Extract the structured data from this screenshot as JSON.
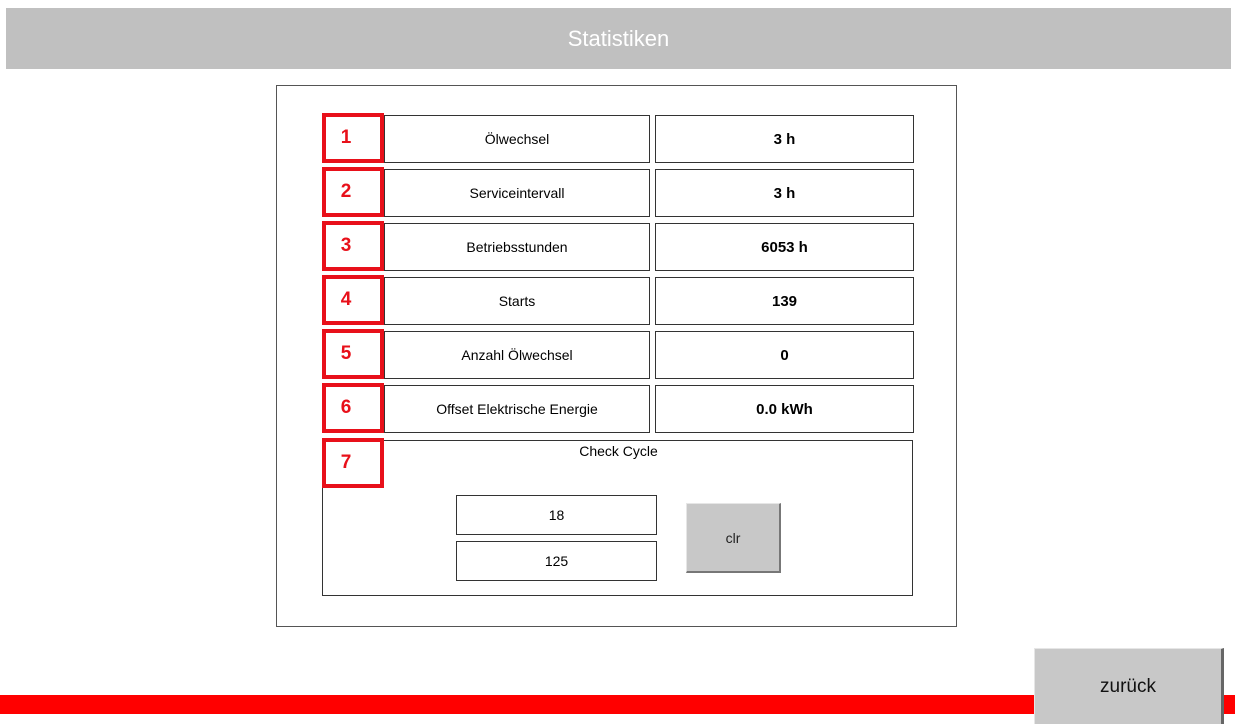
{
  "header": {
    "title": "Statistiken"
  },
  "rows": [
    {
      "marker": "1",
      "label": "Ölwechsel",
      "value": "3 h"
    },
    {
      "marker": "2",
      "label": "Serviceintervall",
      "value": "3 h"
    },
    {
      "marker": "3",
      "label": "Betriebsstunden",
      "value": "6053 h"
    },
    {
      "marker": "4",
      "label": "Starts",
      "value": "139"
    },
    {
      "marker": "5",
      "label": "Anzahl Ölwechsel",
      "value": "0"
    },
    {
      "marker": "6",
      "label": "Offset Elektrische Energie",
      "value": "0.0 kWh"
    }
  ],
  "check_cycle": {
    "marker": "7",
    "title": "Check Cycle",
    "value_1": "18",
    "value_2": "125",
    "clear_label": "clr"
  },
  "footer": {
    "back_label": "zurück"
  },
  "colors": {
    "header_bg": "#c0c0c0",
    "accent_red": "#ff0000",
    "marker_red": "#e8101a",
    "button_gray": "#c8c8c8"
  }
}
